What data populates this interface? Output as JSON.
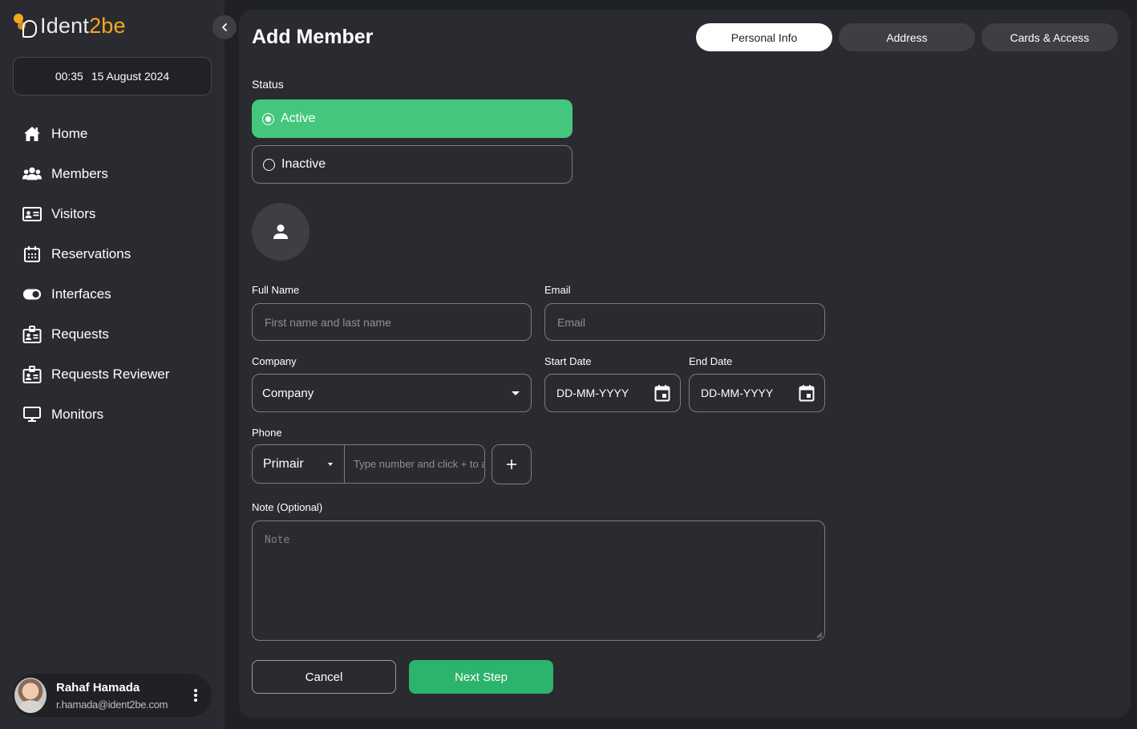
{
  "brand": {
    "name_prefix": "Ident",
    "name_suffix": "2be",
    "accent_color": "#f6a821"
  },
  "clock": {
    "time": "00:35",
    "date": "15 August 2024"
  },
  "sidebar": {
    "items": [
      {
        "label": "Home",
        "icon": "home-icon"
      },
      {
        "label": "Members",
        "icon": "members-icon"
      },
      {
        "label": "Visitors",
        "icon": "visitor-card-icon"
      },
      {
        "label": "Reservations",
        "icon": "calendar-icon"
      },
      {
        "label": "Interfaces",
        "icon": "toggle-icon"
      },
      {
        "label": "Requests",
        "icon": "badge-icon"
      },
      {
        "label": "Requests Reviewer",
        "icon": "badge-icon"
      },
      {
        "label": "Monitors",
        "icon": "monitor-icon"
      }
    ]
  },
  "user": {
    "name": "Rahaf Hamada",
    "email": "r.hamada@ident2be.com"
  },
  "page": {
    "title": "Add Member"
  },
  "tabs": [
    {
      "label": "Personal Info",
      "active": true
    },
    {
      "label": "Address",
      "active": false
    },
    {
      "label": "Cards & Access",
      "active": false
    }
  ],
  "status": {
    "label": "Status",
    "options": [
      {
        "label": "Active",
        "selected": true,
        "color": "#44c77d"
      },
      {
        "label": "Inactive",
        "selected": false
      }
    ]
  },
  "form": {
    "full_name": {
      "label": "Full Name",
      "placeholder": "First name and last name",
      "value": ""
    },
    "email": {
      "label": "Email",
      "placeholder": "Email",
      "value": ""
    },
    "company": {
      "label": "Company",
      "value": "Company"
    },
    "start_date": {
      "label": "Start Date",
      "value": "DD-MM-YYYY"
    },
    "end_date": {
      "label": "End Date",
      "value": "DD-MM-YYYY"
    },
    "phone": {
      "label": "Phone",
      "type": "Primair",
      "placeholder": "Type number and click + to add",
      "value": ""
    },
    "note": {
      "label": "Note (Optional)",
      "placeholder": "Note",
      "value": ""
    }
  },
  "actions": {
    "cancel_label": "Cancel",
    "next_label": "Next Step",
    "primary_color": "#2db36b"
  }
}
